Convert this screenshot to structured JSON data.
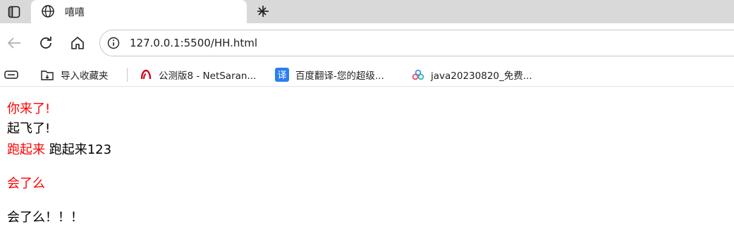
{
  "browser": {
    "tab": {
      "title": "嘻嘻"
    },
    "address": {
      "url": "127.0.0.1:5500/HH.html"
    },
    "bookmarks": [
      {
        "label": "导入收藏夹",
        "icon": "folder-import-icon"
      },
      {
        "label": "公测版8 - NetSaran...",
        "icon": "netsarang-icon"
      },
      {
        "label": "百度翻译-您的超级...",
        "icon": "baidu-translate-icon"
      },
      {
        "label": "java20230820_免费...",
        "icon": "cloud-icon"
      }
    ]
  },
  "page": {
    "line1": "你来了!",
    "line2": "起飞了!",
    "line3_red": "跑起来",
    "line3_black": "跑起来123",
    "line4": "会了么",
    "line5": "会了么！！！"
  },
  "colors": {
    "red": "#ff0000",
    "black": "#000000"
  }
}
